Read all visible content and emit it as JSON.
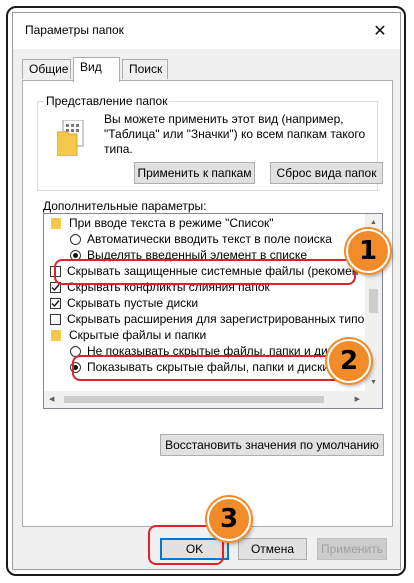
{
  "window": {
    "title": "Параметры папок",
    "close_glyph": "✕"
  },
  "tabs": [
    {
      "label": "Общие"
    },
    {
      "label": "Вид"
    },
    {
      "label": "Поиск"
    }
  ],
  "folder_view": {
    "legend": "Представление папок",
    "description": "Вы можете применить этот вид (например, \"Таблица\" или \"Значки\") ко всем папкам такого типа.",
    "apply_button": "Применить к папкам",
    "reset_button": "Сброс вида папок"
  },
  "advanced": {
    "label": "Дополнительные параметры:",
    "items": [
      {
        "kind": "folder",
        "label": "При вводе текста в режиме \"Список\""
      },
      {
        "kind": "radio",
        "checked": false,
        "label": "Автоматически вводить текст в поле поиска"
      },
      {
        "kind": "radio",
        "checked": true,
        "label": "Выделять введенный элемент в списке"
      },
      {
        "kind": "checkbox",
        "checked": false,
        "label": "Скрывать защищенные системные файлы (рекомен"
      },
      {
        "kind": "checkbox",
        "checked": true,
        "label": "Скрывать конфликты слияния папок"
      },
      {
        "kind": "checkbox",
        "checked": true,
        "label": "Скрывать пустые диски"
      },
      {
        "kind": "checkbox",
        "checked": false,
        "label": "Скрывать расширения для зарегистрированных типо"
      },
      {
        "kind": "folder",
        "label": "Скрытые файлы и папки"
      },
      {
        "kind": "radio",
        "checked": false,
        "label": "Не показывать скрытые файлы, папки и диски"
      },
      {
        "kind": "radio",
        "checked": true,
        "label": "Показывать скрытые файлы, папки и диски"
      }
    ],
    "restore_button": "Восстановить значения по умолчанию"
  },
  "buttons": {
    "ok": "OK",
    "cancel": "Отмена",
    "apply": "Применить"
  },
  "callouts": [
    {
      "number": "1"
    },
    {
      "number": "2"
    },
    {
      "number": "3"
    }
  ],
  "colors": {
    "accent": "#0078d7",
    "callout_border": "#e0202a",
    "badge": "#f28c2a",
    "folder": "#f5c84c"
  }
}
